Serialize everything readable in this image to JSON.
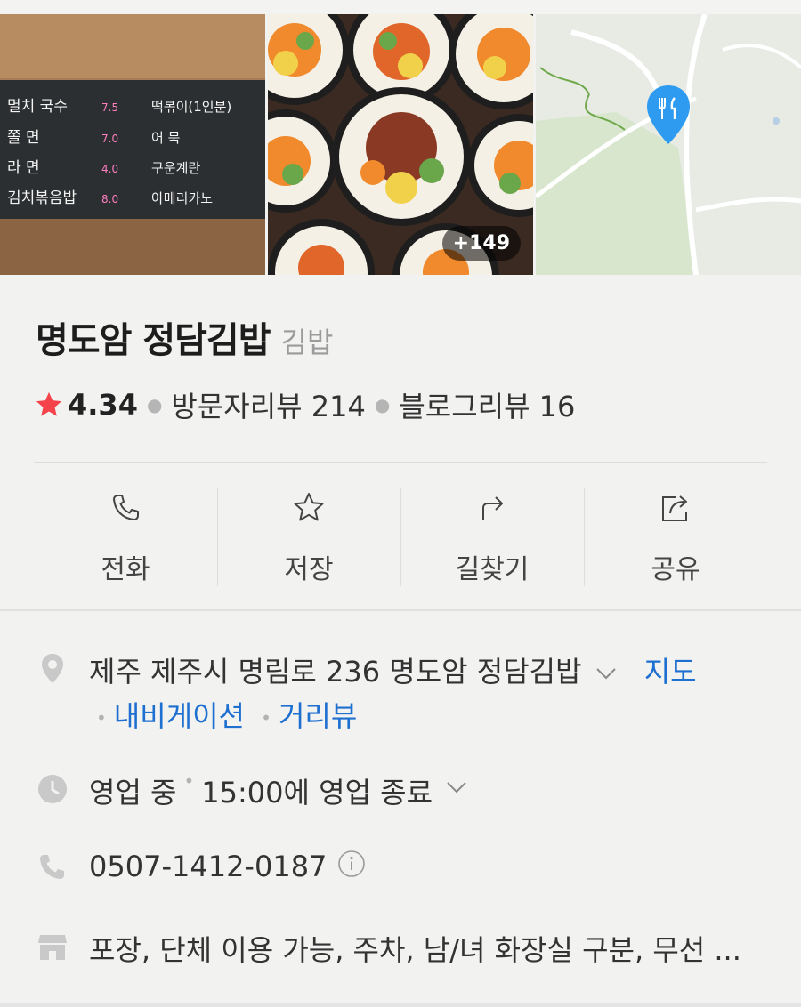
{
  "gallery": {
    "menu_board": {
      "items": [
        {
          "name": "멸치 국수",
          "price": "7.5"
        },
        {
          "name": "쫄 면",
          "price": "7.0"
        },
        {
          "name": "라 면",
          "price": "4.0"
        },
        {
          "name": "김치볶음밥",
          "price": "8.0"
        }
      ],
      "items_right": [
        "떡볶이(1인분)",
        "어 묵",
        "구운계란",
        "아메리카노"
      ]
    },
    "more_count": "+149"
  },
  "place": {
    "name": "명도암 정담김밥",
    "category": "김밥",
    "rating": "4.34",
    "visitor_reviews": "방문자리뷰 214",
    "blog_reviews": "블로그리뷰 16"
  },
  "actions": [
    {
      "label": "전화",
      "icon": "phone-icon"
    },
    {
      "label": "저장",
      "icon": "star-icon"
    },
    {
      "label": "길찾기",
      "icon": "directions-icon"
    },
    {
      "label": "공유",
      "icon": "share-icon"
    }
  ],
  "info": {
    "address": "제주 제주시 명림로 236 명도암 정담김밥",
    "map_link": "지도",
    "navigation_link": "내비게이션",
    "street_view_link": "거리뷰",
    "status": "영업 중",
    "hours": "15:00에 영업 종료",
    "phone": "0507-1412-0187",
    "amenities": "포장, 단체 이용 가능, 주차, 남/녀 화장실 구분, 무선 ..."
  },
  "colors": {
    "accent_link": "#1d6fd0",
    "star": "#f5434c",
    "map_pin": "#2f9bf0"
  }
}
